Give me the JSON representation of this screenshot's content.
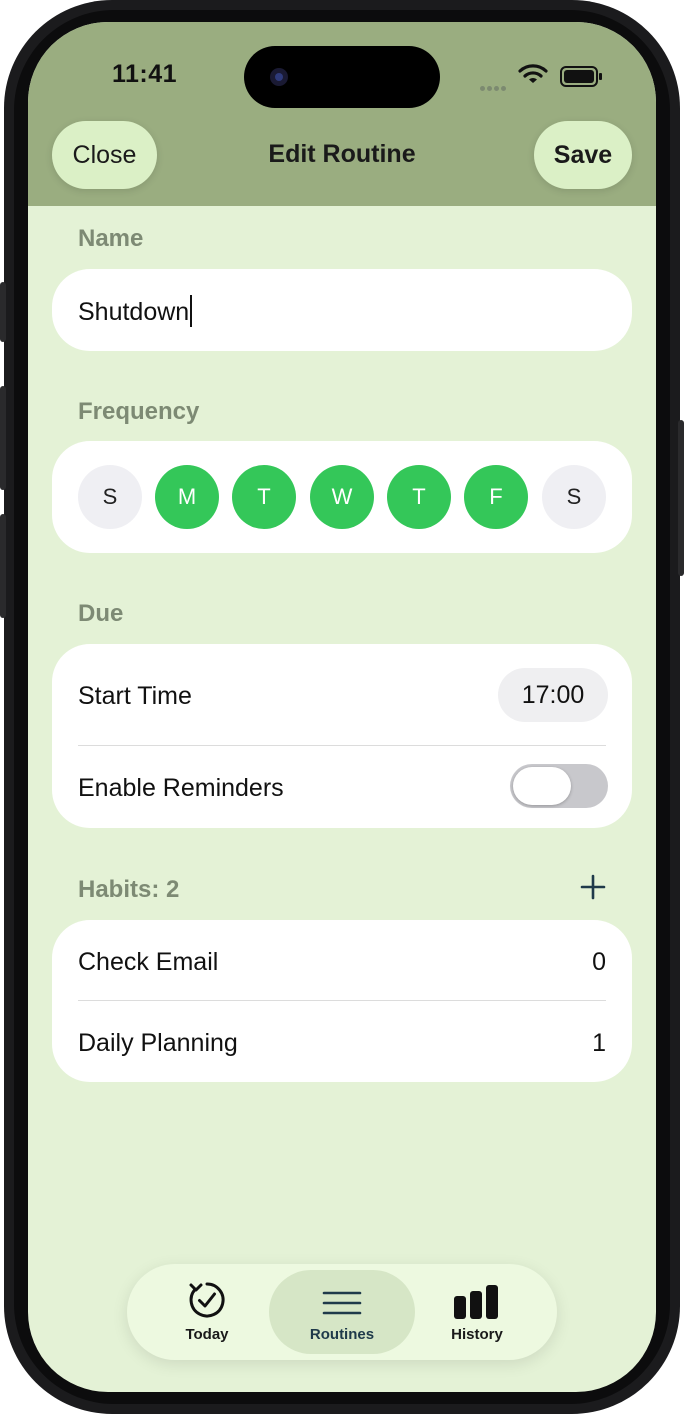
{
  "status_bar": {
    "time": "11:41"
  },
  "header": {
    "close_label": "Close",
    "title": "Edit Routine",
    "save_label": "Save"
  },
  "name_section": {
    "label": "Name",
    "value": "Shutdown"
  },
  "frequency_section": {
    "label": "Frequency",
    "days": [
      {
        "letter": "S",
        "selected": false
      },
      {
        "letter": "M",
        "selected": true
      },
      {
        "letter": "T",
        "selected": true
      },
      {
        "letter": "W",
        "selected": true
      },
      {
        "letter": "T",
        "selected": true
      },
      {
        "letter": "F",
        "selected": true
      },
      {
        "letter": "S",
        "selected": false
      }
    ]
  },
  "due_section": {
    "label": "Due",
    "start_time_label": "Start Time",
    "start_time_value": "17:00",
    "reminders_label": "Enable Reminders",
    "reminders_enabled": false
  },
  "habits_section": {
    "label": "Habits: 2",
    "items": [
      {
        "name": "Check Email",
        "value": "0"
      },
      {
        "name": "Daily Planning",
        "value": "1"
      }
    ]
  },
  "tab_bar": {
    "tabs": [
      {
        "label": "Today",
        "icon": "circular-check-icon",
        "active": false
      },
      {
        "label": "Routines",
        "icon": "list-lines-icon",
        "active": true
      },
      {
        "label": "History",
        "icon": "bar-chart-icon",
        "active": false
      }
    ]
  },
  "colors": {
    "accent_green": "#34c759",
    "header_bg": "#9aad80",
    "screen_bg": "#e4f2d6"
  }
}
